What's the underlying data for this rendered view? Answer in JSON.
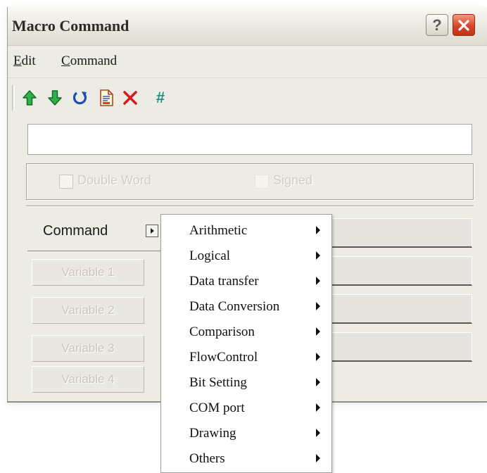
{
  "window": {
    "title": "Macro Command",
    "help_label": "?"
  },
  "menubar": {
    "edit": {
      "mnemonic": "E",
      "rest": "dit"
    },
    "command": {
      "mnemonic": "C",
      "rest": "ommand"
    }
  },
  "toolbar": {
    "icons": [
      "arrow-up-icon",
      "arrow-down-icon",
      "undo-icon",
      "document-icon",
      "delete-icon",
      "hash-icon"
    ],
    "hash_label": "#"
  },
  "command_input": {
    "value": ""
  },
  "options": {
    "double_word": "Double Word",
    "signed": "Signed"
  },
  "form": {
    "command_label": "Command",
    "variables": [
      "Variable 1",
      "Variable 2",
      "Variable 3",
      "Variable 4"
    ]
  },
  "command_menu": {
    "items": [
      "Arithmetic",
      "Logical",
      "Data transfer",
      "Data Conversion",
      "Comparison",
      "FlowControl",
      "Bit Setting",
      "COM port",
      "Drawing",
      "Others"
    ]
  },
  "colors": {
    "accent_green": "#1d9a3a",
    "accent_red": "#d6452a",
    "window_bg": "#ecebe4"
  }
}
